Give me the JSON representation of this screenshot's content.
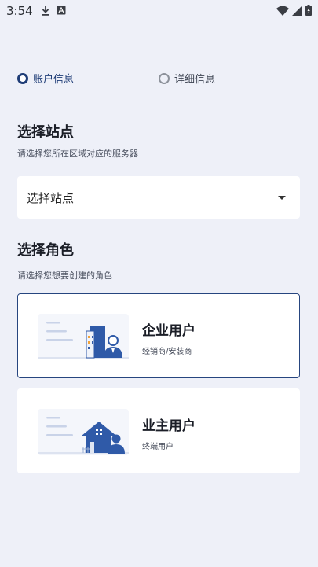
{
  "status_bar": {
    "time": "3:54",
    "left_icons": [
      "download-icon",
      "a-box-icon"
    ],
    "right_icons": [
      "wifi-icon",
      "signal-icon",
      "battery-icon"
    ]
  },
  "steps": [
    {
      "label": "账户信息",
      "state": "active"
    },
    {
      "label": "详细信息",
      "state": "inactive"
    }
  ],
  "site_section": {
    "title": "选择站点",
    "subtitle": "请选择您所在区域对应的服务器",
    "select_value": "选择站点"
  },
  "role_section": {
    "title": "选择角色",
    "subtitle": "请选择您想要创建的角色"
  },
  "roles": [
    {
      "title": "企业用户",
      "desc": "经销商/安装商",
      "selected": true,
      "icon": "enterprise-user-illustration"
    },
    {
      "title": "业主用户",
      "desc": "终端用户",
      "selected": false,
      "icon": "homeowner-illustration"
    }
  ],
  "colors": {
    "background": "#eef0f8",
    "accent": "#1f3d77",
    "illustration_blue": "#2f5aa8"
  }
}
